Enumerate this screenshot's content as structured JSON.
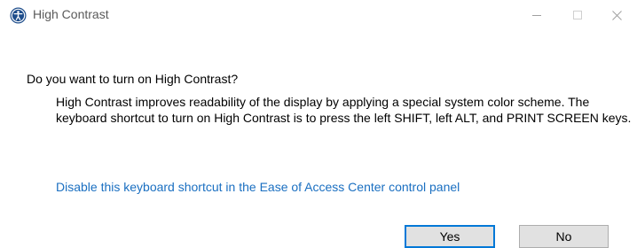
{
  "window": {
    "title": "High Contrast",
    "icon": "ease-of-access-icon",
    "controls": {
      "minimize": "minimize-icon",
      "maximize": "maximize-icon",
      "close": "close-icon"
    }
  },
  "body": {
    "question": "Do you want to turn on High Contrast?",
    "description": "High Contrast improves readability of the display by applying a special system color scheme.  The keyboard shortcut to turn on High Contrast is to press the left SHIFT, left ALT, and PRINT SCREEN keys.",
    "link": "Disable this keyboard shortcut in the Ease of Access Center control panel"
  },
  "buttons": {
    "yes": "Yes",
    "no": "No"
  },
  "colors": {
    "link": "#1a6fc1",
    "icon": "#1f4e8c",
    "focus_border": "#0078d7",
    "button_bg": "#e1e1e1"
  }
}
